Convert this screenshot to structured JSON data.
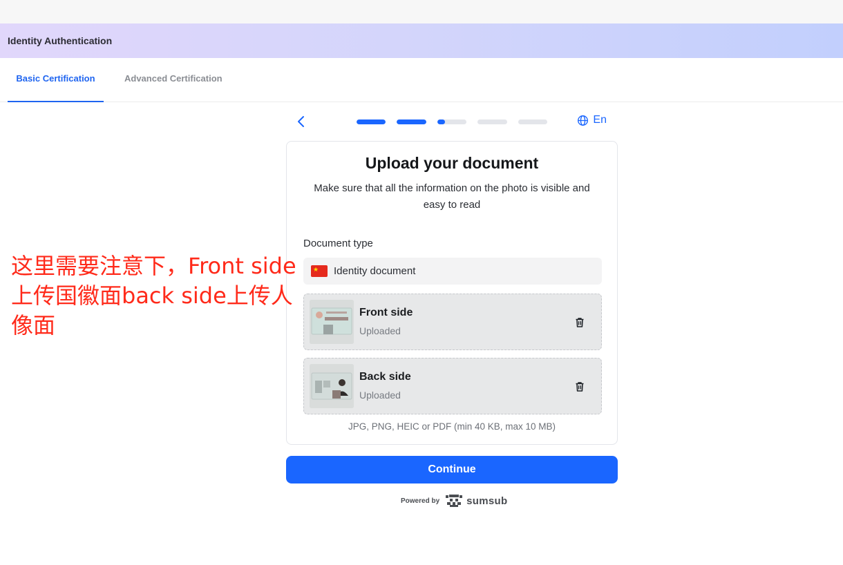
{
  "header": {
    "title": "Identity Authentication"
  },
  "tabs": [
    {
      "label": "Basic Certification",
      "active": true
    },
    {
      "label": "Advanced Certification",
      "active": false
    }
  ],
  "progress": {
    "steps": [
      1,
      1,
      0.25,
      0,
      0
    ]
  },
  "language": {
    "label": "En"
  },
  "card": {
    "title": "Upload your document",
    "subtitle": "Make sure that all the information on the photo is visible and easy to read",
    "document_type_label": "Document type",
    "document_type_value": "Identity document",
    "uploads": [
      {
        "name": "Front side",
        "status": "Uploaded"
      },
      {
        "name": "Back side",
        "status": "Uploaded"
      }
    ],
    "file_hint": "JPG, PNG, HEIC or PDF (min 40 KB, max 10 MB)"
  },
  "continue_label": "Continue",
  "footer": {
    "powered_by": "Powered by",
    "brand": "sumsub"
  },
  "annotation": "这里需要注意下，Front side上传国徽面back side上传人像面",
  "colors": {
    "accent": "#1a66ff",
    "annotation": "#ff2a1a",
    "flag": "#e52a1d"
  },
  "icons": [
    "back-arrow-icon",
    "globe-icon",
    "china-flag-icon",
    "trash-icon",
    "sumsub-logo-icon"
  ]
}
